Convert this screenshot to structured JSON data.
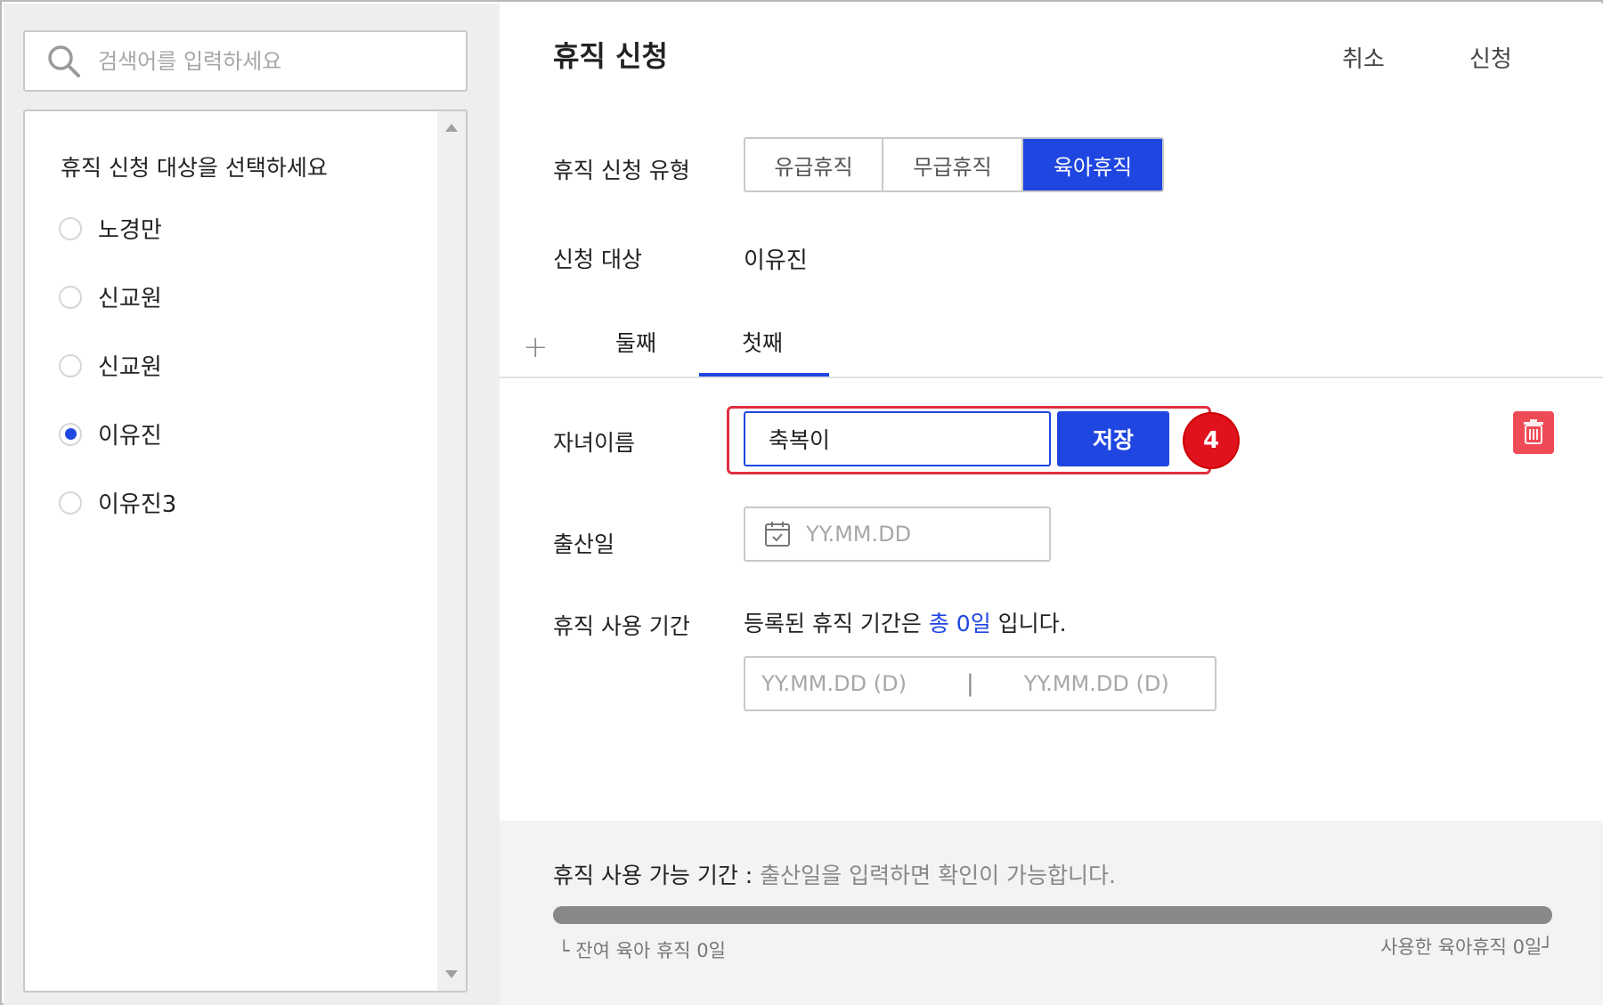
{
  "search": {
    "placeholder": "검색어를 입력하세요",
    "icon": "search-icon"
  },
  "target_list": {
    "title": "휴직 신청 대상을 선택하세요",
    "items": [
      {
        "label": "노경만",
        "selected": false
      },
      {
        "label": "신교원",
        "selected": false
      },
      {
        "label": "신교원",
        "selected": false
      },
      {
        "label": "이유진",
        "selected": true
      },
      {
        "label": "이유진3",
        "selected": false
      }
    ]
  },
  "header": {
    "title": "휴직 신청",
    "cancel_label": "취소",
    "submit_label": "신청"
  },
  "leave_type": {
    "label": "휴직 신청 유형",
    "options": [
      "유급휴직",
      "무급휴직",
      "육아휴직"
    ],
    "selected": "육아휴직"
  },
  "applicant": {
    "label": "신청 대상",
    "value": "이유진"
  },
  "child_tabs": {
    "tabs": [
      "둘째",
      "첫째"
    ],
    "active": "첫째"
  },
  "child_form": {
    "name_label": "자녀이름",
    "name_value": "축복이",
    "save_label": "저장",
    "step_badge": "4",
    "birth_label": "출산일",
    "birth_placeholder": "YY.MM.DD",
    "period_label": "휴직 사용 기간",
    "period_text_prefix": "등록된 휴직 기간은 ",
    "period_text_accent": "총 0일",
    "period_text_suffix": " 입니다.",
    "range_start_placeholder": "YY.MM.DD (D)",
    "range_separator": "|",
    "range_end_placeholder": "YY.MM.DD (D)"
  },
  "availability": {
    "label": "휴직 사용 가능 기간 : ",
    "message": "출산일을 입력하면 확인이 가능합니다.",
    "progress_fraction": 0,
    "remaining_text": "└ 잔여 육아 휴직 0일",
    "used_text": "사용한 육아휴직 0일┘"
  },
  "colors": {
    "accent": "#1f46e0",
    "badge_red": "#e0121e",
    "delete_red": "#ef4b56"
  }
}
